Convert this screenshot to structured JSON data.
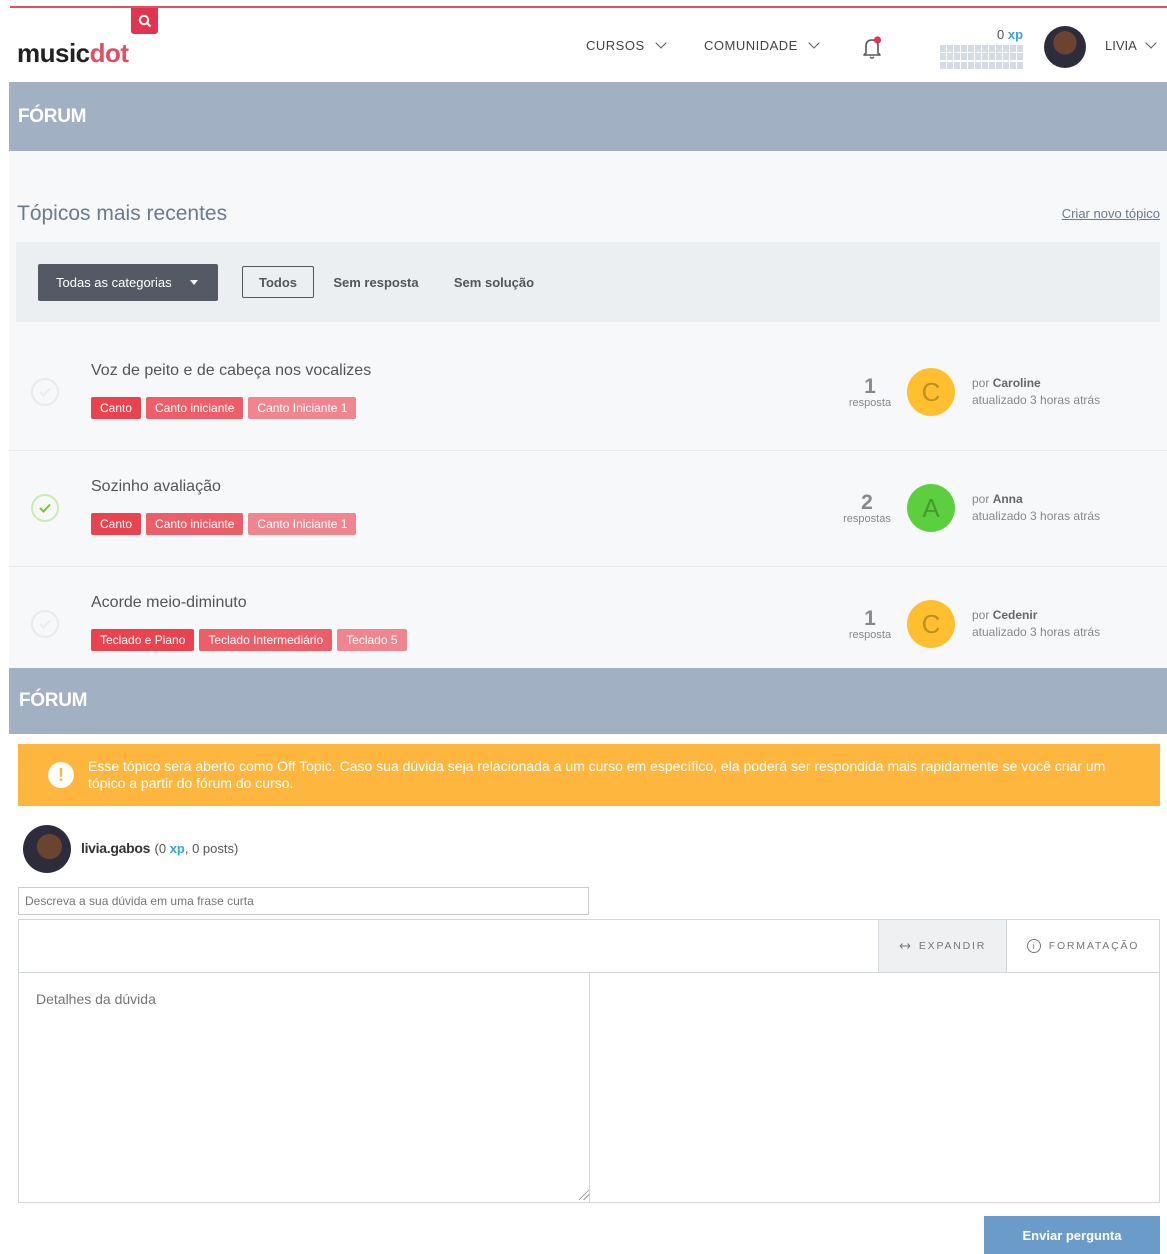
{
  "header": {
    "logo_text_1": "music",
    "logo_text_2": "dot",
    "nav": [
      {
        "label": "CURSOS"
      },
      {
        "label": "COMUNIDADE"
      }
    ],
    "xp_value": "0",
    "xp_unit": "xp",
    "user_label": "LIVIA"
  },
  "forum_band_title": "FÓRUM",
  "forum_band_title_2": "FÓRUM",
  "section": {
    "title": "Tópicos mais recentes",
    "create_link": "Criar novo tópico"
  },
  "filters": {
    "category_select": "Todas as categorias",
    "tabs": [
      "Todos",
      "Sem resposta",
      "Sem solução"
    ]
  },
  "topics": [
    {
      "title": "Voz de peito e de cabeça nos vocalizes",
      "tags": [
        "Canto",
        "Canto iniciante",
        "Canto Iniciante 1"
      ],
      "count": "1",
      "count_label": "resposta",
      "avatar_letter": "C",
      "by": "por",
      "author": "Caroline",
      "updated": "atualizado 3 horas atrás",
      "solved": false
    },
    {
      "title": "Sozinho avaliação",
      "tags": [
        "Canto",
        "Canto iniciante",
        "Canto Iniciante 1"
      ],
      "count": "2",
      "count_label": "respostas",
      "avatar_letter": "A",
      "by": "por",
      "author": "Anna",
      "updated": "atualizado 3 horas atrás",
      "solved": true
    },
    {
      "title": "Acorde meio-diminuto",
      "tags": [
        "Teclado e Piano",
        "Teclado Intermediário",
        "Teclado 5"
      ],
      "count": "1",
      "count_label": "resposta",
      "avatar_letter": "C",
      "by": "por",
      "author": "Cedenir",
      "updated": "atualizado 3 horas atrás",
      "solved": false
    }
  ],
  "warning": {
    "icon": "!",
    "text": "Esse tópico será aberto como Off Topic. Caso sua dúvida seja relacionada a um curso em específico, ela poderá ser respondida mais rapidamente se você criar um tópico a partir do fórum do curso."
  },
  "composer": {
    "username": "livia.gabos",
    "meta_open": "(0 ",
    "meta_xp": "xp",
    "meta_close": ", 0 posts)",
    "short_placeholder": "Descreva a sua dúvida em uma frase curta",
    "expand_label": "EXPANDIR",
    "format_label": "FORMATAÇÃO",
    "details_placeholder": "Detalhes da dúvida",
    "submit_label": "Enviar pergunta"
  },
  "colors": {
    "accent": "#e04f63",
    "band": "#a1b0c2",
    "tag_primary": "#e8434f",
    "tag_secondary": "#ec5f69",
    "tag_tertiary": "#f0858f",
    "avatar_c": "#ffbf2f",
    "avatar_a": "#5ccf3e",
    "warning": "#ffb63f",
    "submit": "#6b9bc9"
  }
}
